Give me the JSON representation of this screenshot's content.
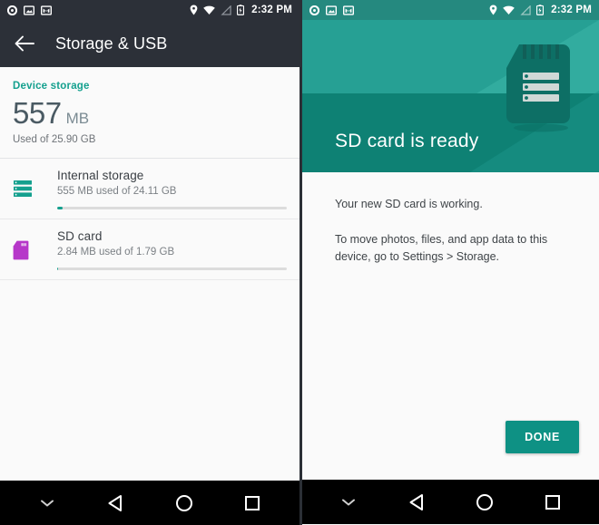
{
  "left_screen": {
    "status_bar": {
      "time": "2:32 PM",
      "left_icons": [
        "record-dot-icon",
        "image-icon",
        "gmail-icon"
      ],
      "right_icons": [
        "location-pin-icon",
        "wifi-icon",
        "cellular-signal-off-icon",
        "battery-charging-icon"
      ]
    },
    "app_bar": {
      "back_icon": "arrow-back-icon",
      "title": "Storage & USB"
    },
    "device_storage": {
      "section_label": "Device storage",
      "amount": "557",
      "unit": "MB",
      "used_of": "Used of 25.90 GB"
    },
    "rows": [
      {
        "icon": "internal-storage-icon",
        "title": "Internal storage",
        "subtitle": "555 MB used of 24.11 GB",
        "progress_percent": 2.3
      },
      {
        "icon": "sd-card-icon",
        "title": "SD card",
        "subtitle": "2.84 MB used of 1.79 GB",
        "progress_percent": 0.2
      }
    ],
    "nav_bar": {
      "items": [
        "chevron-down-icon",
        "back-triangle-icon",
        "home-circle-icon",
        "recents-square-icon"
      ]
    }
  },
  "right_screen": {
    "status_bar": {
      "time": "2:32 PM",
      "left_icons": [
        "record-dot-icon",
        "image-icon",
        "gmail-icon"
      ],
      "right_icons": [
        "location-pin-icon",
        "wifi-icon",
        "cellular-signal-off-icon",
        "battery-charging-icon"
      ]
    },
    "hero": {
      "title": "SD card is ready",
      "artwork": "sd-card-illustration"
    },
    "body": {
      "paragraph_1": "Your new SD card is working.",
      "paragraph_2": "To move photos, files, and app data to this device, go to Settings > Storage."
    },
    "done_button": "DONE",
    "nav_bar": {
      "items": [
        "chevron-down-icon",
        "back-triangle-icon",
        "home-circle-icon",
        "recents-square-icon"
      ]
    }
  },
  "colors": {
    "status_bar_dark": "#2c3038",
    "app_bar_dark": "#2c3038",
    "accent_teal": "#14a08e",
    "hero_teal_light": "#26a094",
    "hero_teal_dark": "#0e8174",
    "sd_card_purple": "#b637c9",
    "button_teal": "#0e9184",
    "page_background": "#fafafa",
    "nav_bar_black": "#000000"
  }
}
